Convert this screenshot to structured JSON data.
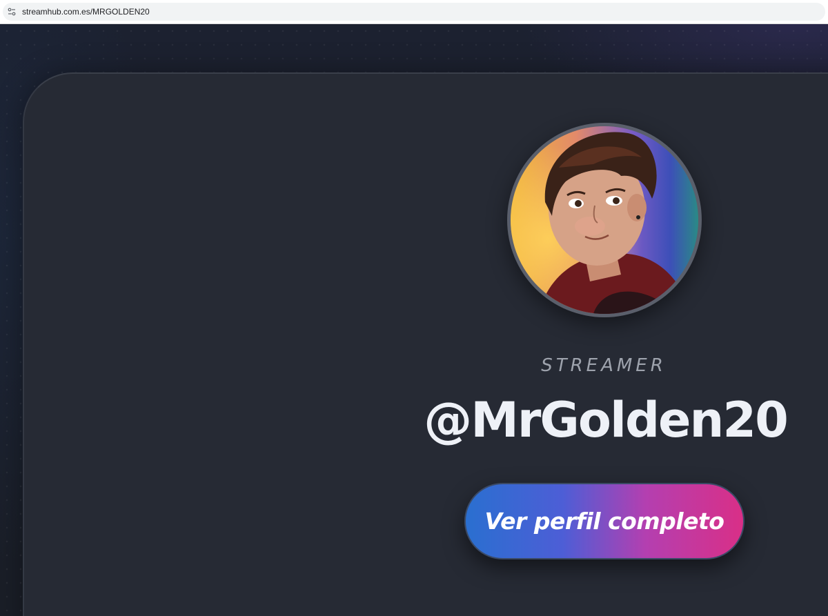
{
  "browser": {
    "url": "streamhub.com.es/MRGOLDEN20",
    "site_info_icon": "tune-icon"
  },
  "profile": {
    "role": "STREAMER",
    "handle": "@MrGolden20",
    "avatar_icon": "avatar-illustration"
  },
  "cta": {
    "label": "Ver perfil completo"
  },
  "colors": {
    "page_bg": "#1b1f27",
    "card_bg": "#262a34",
    "handle_text": "#eef1f7",
    "role_text": "#9ea3ad",
    "cta_gradient_start": "#2a6fd0",
    "cta_gradient_end": "#d92f87"
  }
}
